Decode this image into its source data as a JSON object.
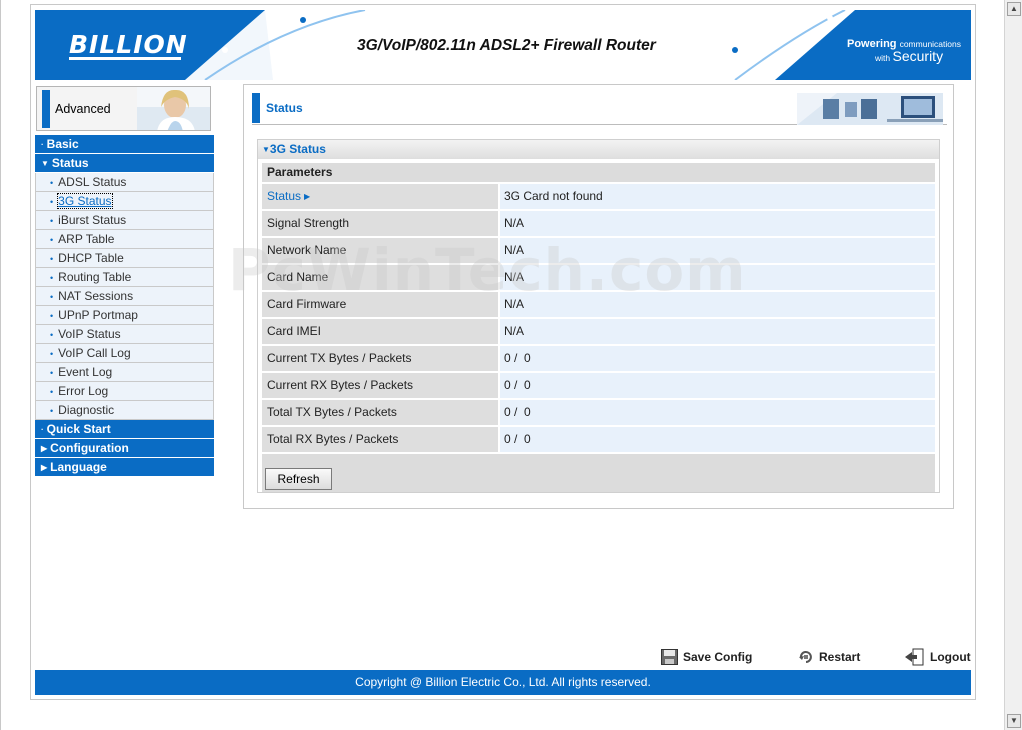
{
  "header": {
    "logo": "BILLION",
    "product_title": "3G/VoIP/802.11n ADSL2+ Firewall Router",
    "tagline_line1_bold": "Powering",
    "tagline_line1_small": "communications",
    "tagline_line2_small": "with",
    "tagline_line2_bold": "Security"
  },
  "sidebar": {
    "mode_label": "Advanced",
    "items": [
      {
        "label": "Basic",
        "type": "main",
        "expanded": false
      },
      {
        "label": "Status",
        "type": "main",
        "expanded": true
      },
      {
        "label": "ADSL Status",
        "type": "sub"
      },
      {
        "label": "3G Status",
        "type": "sub",
        "active": true
      },
      {
        "label": "iBurst Status",
        "type": "sub"
      },
      {
        "label": "ARP Table",
        "type": "sub"
      },
      {
        "label": "DHCP Table",
        "type": "sub"
      },
      {
        "label": "Routing Table",
        "type": "sub"
      },
      {
        "label": "NAT Sessions",
        "type": "sub"
      },
      {
        "label": "UPnP Portmap",
        "type": "sub"
      },
      {
        "label": "VoIP Status",
        "type": "sub"
      },
      {
        "label": "VoIP Call Log",
        "type": "sub"
      },
      {
        "label": "Event Log",
        "type": "sub"
      },
      {
        "label": "Error Log",
        "type": "sub"
      },
      {
        "label": "Diagnostic",
        "type": "sub"
      },
      {
        "label": "Quick Start",
        "type": "main",
        "expanded": false
      },
      {
        "label": "Configuration",
        "type": "main",
        "expanded": false
      },
      {
        "label": "Language",
        "type": "main",
        "expanded": false
      }
    ]
  },
  "main": {
    "page_title": "Status",
    "section_title": "3G Status",
    "params_header": "Parameters",
    "rows": [
      {
        "key": "Status",
        "value": "3G Card not found"
      },
      {
        "key": "Signal Strength",
        "value": "N/A"
      },
      {
        "key": "Network Name",
        "value": "N/A"
      },
      {
        "key": "Card Name",
        "value": "N/A"
      },
      {
        "key": "Card Firmware",
        "value": "N/A"
      },
      {
        "key": "Card IMEI",
        "value": "N/A"
      },
      {
        "key": "Current TX Bytes / Packets",
        "value": "0 /  0"
      },
      {
        "key": "Current RX Bytes / Packets",
        "value": "0 /  0"
      },
      {
        "key": "Total TX Bytes / Packets",
        "value": "0 /  0"
      },
      {
        "key": "Total RX Bytes / Packets",
        "value": "0 /  0"
      }
    ],
    "refresh_label": "Refresh"
  },
  "watermark": "PcWinTech.com",
  "actions": {
    "save_config": "Save Config",
    "restart": "Restart",
    "logout": "Logout"
  },
  "footer": {
    "copyright": "Copyright @ Billion Electric Co., Ltd. All rights reserved."
  },
  "colors": {
    "brand_blue": "#0a6cc4",
    "row_key_bg": "#dedede",
    "row_value_bg": "#e8f1fb"
  }
}
